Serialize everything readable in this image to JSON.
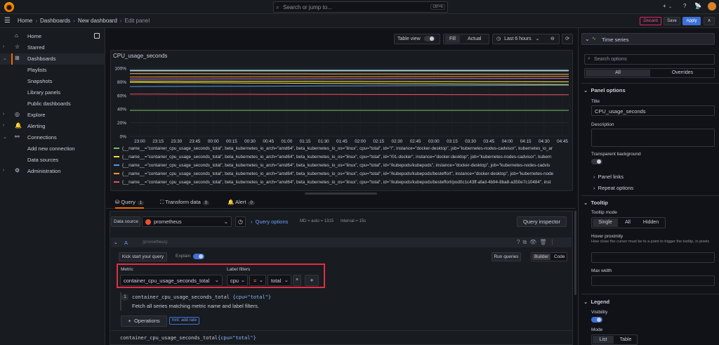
{
  "topbar": {
    "search_placeholder": "Search or jump to...",
    "search_shortcut": "ctrl+k",
    "new_icon": "+",
    "help_icon": "?",
    "news_icon": "📡"
  },
  "breadcrumbs": [
    {
      "label": "Home"
    },
    {
      "label": "Dashboards"
    },
    {
      "label": "New dashboard"
    },
    {
      "label": "Edit panel"
    }
  ],
  "actions": {
    "discard": "Discard",
    "save": "Save",
    "apply": "Apply"
  },
  "sidebar": {
    "items": [
      {
        "label": "Home",
        "icon": "⌂",
        "chev": ""
      },
      {
        "label": "Starred",
        "icon": "☆",
        "chev": "›"
      },
      {
        "label": "Dashboards",
        "icon": "⊞",
        "chev": "⌄"
      },
      {
        "label": "Playlists",
        "icon": "",
        "chev": ""
      },
      {
        "label": "Snapshots",
        "icon": "",
        "chev": ""
      },
      {
        "label": "Library panels",
        "icon": "",
        "chev": ""
      },
      {
        "label": "Public dashboards",
        "icon": "",
        "chev": ""
      },
      {
        "label": "Explore",
        "icon": "◎",
        "chev": "›"
      },
      {
        "label": "Alerting",
        "icon": "🔔",
        "chev": "›"
      },
      {
        "label": "Connections",
        "icon": "⚯",
        "chev": "⌄"
      },
      {
        "label": "Add new connection",
        "icon": "",
        "chev": ""
      },
      {
        "label": "Data sources",
        "icon": "",
        "chev": ""
      },
      {
        "label": "Administration",
        "icon": "⚙",
        "chev": "›"
      }
    ]
  },
  "panel_toolbar": {
    "table_view": "Table view",
    "fill": "Fill",
    "actual": "Actual",
    "time_range": "Last 6 hours",
    "zoom_icon": "⊖",
    "refresh_icon": "⟳"
  },
  "panel": {
    "title": "CPU_usage_seconds"
  },
  "chart_data": {
    "type": "line",
    "title": "CPU_usage_seconds",
    "x": [
      "23:00",
      "23:15",
      "23:30",
      "23:45",
      "00:00",
      "00:15",
      "00:30",
      "00:45",
      "01:00",
      "01:15",
      "01:30",
      "01:45",
      "02:00",
      "02:15",
      "02:30",
      "02:45",
      "03:00",
      "03:15",
      "03:30",
      "03:45",
      "04:00",
      "04:15",
      "04:30",
      "04:45"
    ],
    "ylim": [
      0,
      100
    ],
    "y_ticks": [
      "0%",
      "20%",
      "40%",
      "60%",
      "80%",
      "100%"
    ],
    "grid": true,
    "legend_position": "bottom",
    "series": [
      {
        "name": "{__name__=\"container_cpu_usage_seconds_total\", beta_kubernetes_io_arch=\"amd64\", beta_kubernetes_io_os=\"linux\", cpu=\"total\", id=\"/\", instance=\"docker-desktop\", job=\"kubernetes-nodes-cadvisor\", kubernetes_io_ar",
        "color": "#73bf69",
        "start": 38,
        "end": 38
      },
      {
        "name": "{__name__=\"container_cpu_usage_seconds_total\", beta_kubernetes_io_arch=\"amd64\", beta_kubernetes_io_os=\"linux\", cpu=\"total\", id=\"/01-docker\", instance=\"docker-desktop\", job=\"kubernetes-nodes-cadvisor\", kubern",
        "color": "#fade2a",
        "start": 79,
        "end": 76
      },
      {
        "name": "{__name__=\"container_cpu_usage_seconds_total\", beta_kubernetes_io_arch=\"amd64\", beta_kubernetes_io_os=\"linux\", cpu=\"total\", id=\"/kubepods/kubepods\", instance=\"docker-desktop\", job=\"kubernetes-nodes-cadvis",
        "color": "#5794f2",
        "start": 73,
        "end": 75
      },
      {
        "name": "{__name__=\"container_cpu_usage_seconds_total\", beta_kubernetes_io_arch=\"amd64\", beta_kubernetes_io_os=\"linux\", cpu=\"total\", id=\"/kubepods/kubepods/besteffort\", instance=\"docker-desktop\", job=\"kubernetes-node",
        "color": "#ff9830",
        "start": 87,
        "end": 88
      },
      {
        "name": "{__name__=\"container_cpu_usage_seconds_total\", beta_kubernetes_io_arch=\"amd64\", beta_kubernetes_io_os=\"linux\", cpu=\"total\", id=\"/kubepods/kubepods/besteffort/pod0c1c43ff-afad-4b94-8ba8-a350e7c10484\", inst",
        "color": "#f2495c",
        "start": 62,
        "end": 61
      },
      {
        "name": "",
        "color": "#b877d9",
        "start": 84,
        "end": 85
      },
      {
        "name": "",
        "color": "#8ab8ff",
        "start": 97,
        "end": 97
      },
      {
        "name": "",
        "color": "#ffb357",
        "start": 92,
        "end": 91
      },
      {
        "name": "",
        "color": "#c8f2c2",
        "start": 96,
        "end": 96
      },
      {
        "name": "",
        "color": "#ffee52",
        "start": 81,
        "end": 80
      }
    ]
  },
  "query_tabs": [
    {
      "label": "Query",
      "count": "1",
      "icon": "⛁"
    },
    {
      "label": "Transform data",
      "count": "0",
      "icon": "⛶"
    },
    {
      "label": "Alert",
      "count": "0",
      "icon": "🔔"
    }
  ],
  "query": {
    "datasource_label": "Data source",
    "datasource": "prometheus",
    "query_options": "Query options",
    "md_info": "MD = auto = 1315",
    "interval_info": "Interval = 15s",
    "inspector": "Query inspector",
    "ref_id": "A",
    "ref_ds": "(prometheus)",
    "kickstart": "Kick start your query",
    "explain": "Explain",
    "run_queries": "Run queries",
    "builder": "Builder",
    "code": "Code",
    "metric_label": "Metric",
    "metric_value": "container_cpu_usage_seconds_total",
    "label_filters_label": "Label filters",
    "filter_key": "cpu",
    "filter_op": "=",
    "filter_value": "total",
    "step_num": "1",
    "step_code": "container_cpu_usage_seconds_total",
    "step_code_arg": "{cpu=\"total\"}",
    "step_desc": "Fetch all series matching metric name and label filters.",
    "operations": "Operations",
    "hint": "hint: add rate",
    "preview": "container_cpu_usage_seconds_total",
    "preview_arg": "{cpu=\"total\"}"
  },
  "options_pane": {
    "viz": "Time series",
    "search_placeholder": "Search options",
    "tab_all": "All",
    "tab_overrides": "Overrides",
    "panel_options": "Panel options",
    "title_label": "Title",
    "title_value": "CPU_usage_seconds",
    "description_label": "Description",
    "transparent_label": "Transparent background",
    "panel_links": "Panel links",
    "repeat_options": "Repeat options",
    "tooltip": "Tooltip",
    "tooltip_mode": "Tooltip mode",
    "mode_single": "Single",
    "mode_all": "All",
    "mode_hidden": "Hidden",
    "hover_proximity": "Hover proximity",
    "hover_help": "How close the cursor must be to a point to trigger the tooltip, in pixels",
    "max_width": "Max width",
    "legend": "Legend",
    "visibility": "Visibility",
    "mode": "Mode",
    "mode_list": "List",
    "mode_table": "Table"
  }
}
